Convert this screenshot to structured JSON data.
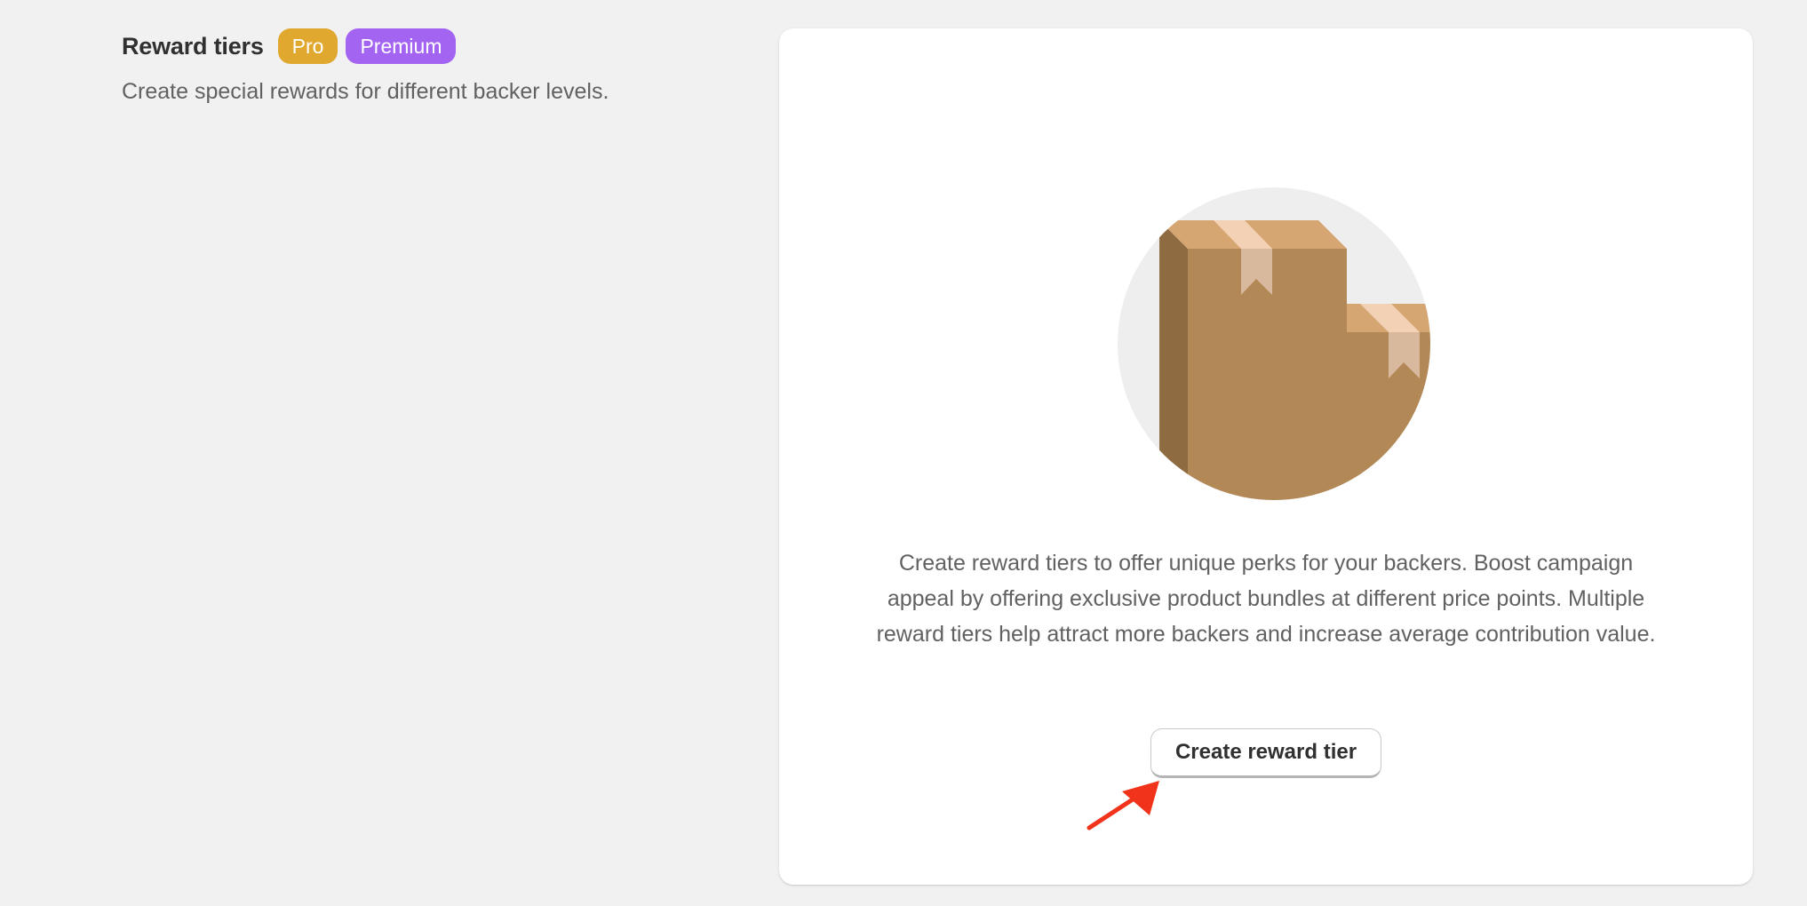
{
  "section": {
    "title": "Reward tiers",
    "badges": [
      {
        "label": "Pro",
        "color": "#e0a82e"
      },
      {
        "label": "Premium",
        "color": "#a464f2"
      }
    ],
    "description": "Create special rewards for different backer levels."
  },
  "empty_state": {
    "illustration_icon": "package-boxes-icon",
    "description": "Create reward tiers to offer unique perks for your backers. Boost campaign appeal by offering exclusive product bundles at different price points. Multiple reward tiers help attract more backers and increase average contribution value.",
    "action_label": "Create reward tier"
  },
  "annotation": {
    "icon": "red-arrow-icon",
    "color": "#f2331b"
  }
}
